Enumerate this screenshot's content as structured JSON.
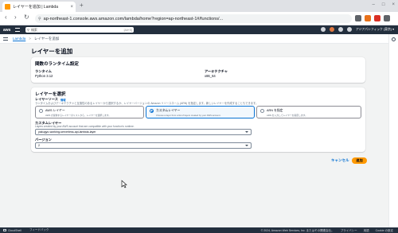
{
  "browser": {
    "tab_title": "レイヤーを追加 | Lambda",
    "tab_close": "×",
    "new_tab": "+",
    "window_controls": [
      "–",
      "□",
      "×"
    ],
    "nav": {
      "back": "‹",
      "forward": "›",
      "reload": "↻"
    },
    "url": "ap-northeast-1.console.aws.amazon.com/lambda/home?region=ap-northeast-1#/functions/...",
    "extension_colors": [
      "#5f6368",
      "#e8711a",
      "#d93025",
      "#5f6368",
      "#1a73e8",
      "#7b1fa2",
      "#5f6368"
    ]
  },
  "aws_header": {
    "logo": "aws",
    "search_placeholder": "検索",
    "search_shortcut": "[Alt+S]",
    "account": "アジアパシフィック (東京) ▾"
  },
  "breadcrumb": {
    "root": "Lambda",
    "separator": ">",
    "current": "レイヤーを追加"
  },
  "page": {
    "title": "レイヤーを追加"
  },
  "runtime_card": {
    "title": "関数のランタイム設定",
    "runtime_label": "ランタイム",
    "runtime_value": "Python 3.12",
    "arch_label": "アーキテクチャ",
    "arch_value": "x86_64"
  },
  "layer_card": {
    "title": "レイヤーを選択",
    "source_label": "レイヤーソース",
    "source_info": "情報",
    "source_desc": "ランタイムおよびアーキテクチャと互換性のあるレイヤーから選択するか、レイヤーバージョンの Amazon リソースネーム (ARN) を指定します。新しいレイヤーを作成することもできます。",
    "options": [
      {
        "label": "AWS レイヤー",
        "desc": "AWS が提供するレイヤーのリストから、レイヤーを選択します。",
        "selected": false
      },
      {
        "label": "カスタムレイヤー",
        "desc": "Choose a layer from a list of layers created by your AWS account.",
        "selected": true
      },
      {
        "label": "ARN を指定",
        "desc": "ARN を入力してレイヤーを指定します。",
        "selected": false
      }
    ],
    "custom_label": "カスタムレイヤー",
    "custom_desc": "Layers created by your AWS account that are compatible with your function's runtime.",
    "custom_value": "yakugyo-working-serverless-api-lambda-layer",
    "version_label": "バージョン",
    "version_value": "2"
  },
  "actions": {
    "cancel": "キャンセル",
    "add": "追加"
  },
  "footer": {
    "cloudshell": "CloudShell",
    "feedback": "フィードバック",
    "copyright": "© 2024, Amazon Web Services, Inc. またはその関連会社。",
    "privacy": "プライバシー",
    "terms": "用語",
    "cookie": "Cookie の設定"
  }
}
